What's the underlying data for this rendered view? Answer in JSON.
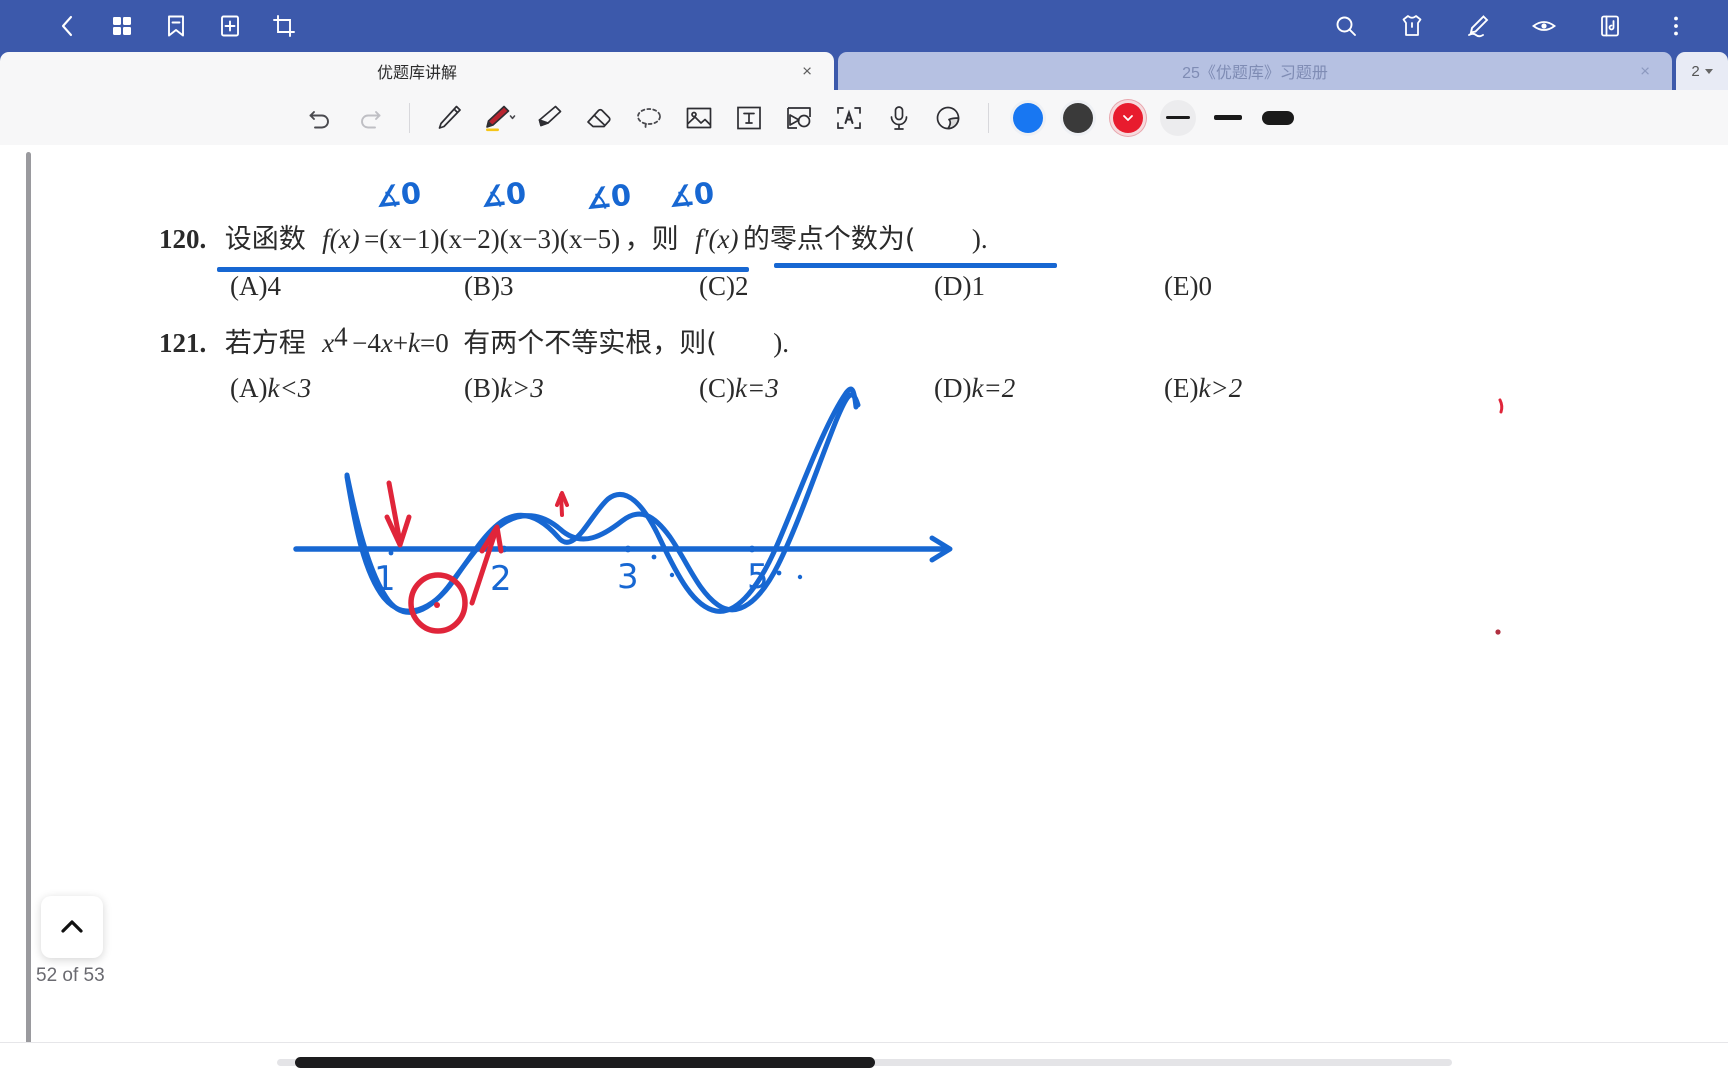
{
  "app": {
    "accent_blue": "#3c59ab",
    "ink_blue": "#1767d2",
    "ink_red": "#e0253a"
  },
  "topbar": {
    "left_icons": [
      {
        "name": "back-icon",
        "label": "Back"
      },
      {
        "name": "grid-thumbnails-icon",
        "label": "Thumbnails"
      },
      {
        "name": "bookmark-icon",
        "label": "Bookmark"
      },
      {
        "name": "add-page-icon",
        "label": "Add page"
      },
      {
        "name": "crop-icon",
        "label": "Crop"
      }
    ],
    "right_icons": [
      {
        "name": "search-icon",
        "label": "Search"
      },
      {
        "name": "shirt-icon",
        "label": "Theme"
      },
      {
        "name": "pen-edit-icon",
        "label": "Edit"
      },
      {
        "name": "eye-icon",
        "label": "View"
      },
      {
        "name": "book-note-icon",
        "label": "Notes"
      },
      {
        "name": "more-vertical-icon",
        "label": "More"
      }
    ]
  },
  "tabs": {
    "items": [
      {
        "label": "优题库讲解",
        "active": true,
        "close": "×"
      },
      {
        "label": "25《优题库》习题册",
        "active": false,
        "close": "×"
      }
    ],
    "counter": "2"
  },
  "drawbar": {
    "tools": [
      {
        "name": "undo-button",
        "label": "Undo"
      },
      {
        "name": "redo-button",
        "label": "Redo"
      },
      {
        "name": "pen-tool",
        "label": "Pen"
      },
      {
        "name": "marker-pen-tool",
        "label": "Marker pen"
      },
      {
        "name": "highlighter-tool",
        "label": "Highlighter"
      },
      {
        "name": "eraser-tool",
        "label": "Eraser"
      },
      {
        "name": "lasso-select-tool",
        "label": "Lasso select"
      },
      {
        "name": "image-insert-tool",
        "label": "Insert image"
      },
      {
        "name": "text-box-tool",
        "label": "Text box"
      },
      {
        "name": "shape-tool",
        "label": "Shapes"
      },
      {
        "name": "ocr-text-tool",
        "label": "Recognize text"
      },
      {
        "name": "microphone-tool",
        "label": "Voice note"
      },
      {
        "name": "shading-tool",
        "label": "Shading"
      }
    ],
    "colors": [
      {
        "name": "color-swatch-blue",
        "hex": "#1877f2",
        "selected": false
      },
      {
        "name": "color-swatch-black",
        "hex": "#3a3a3a",
        "selected": false
      },
      {
        "name": "color-swatch-red",
        "hex": "#e81c2e",
        "selected": true
      }
    ],
    "strokes": [
      {
        "name": "stroke-width-thin",
        "label": "Thin"
      },
      {
        "name": "stroke-width-medium",
        "label": "Medium"
      },
      {
        "name": "stroke-width-thick",
        "label": "Thick"
      }
    ]
  },
  "document": {
    "q120": {
      "number": "120.",
      "stem_cn_1": "设函数",
      "fx": "f(x)",
      "eq": "=(x−1)(x−2)(x−3)(x−5)",
      "stem_cn_2": "，则",
      "fprime": "f′(x)",
      "stem_cn_3": "的零点个数为(",
      "tail": ").",
      "options": [
        {
          "key": "(A)",
          "value": "4"
        },
        {
          "key": "(B)",
          "value": "3"
        },
        {
          "key": "(C)",
          "value": "2"
        },
        {
          "key": "(D)",
          "value": "1"
        },
        {
          "key": "(E)",
          "value": "0"
        }
      ]
    },
    "q121": {
      "number": "121.",
      "stem_cn_1": "若方程",
      "expr_base": "x",
      "expr_sup": "4",
      "expr_rest": "−4x+k=0",
      "stem_cn_2": "有两个不等实根，则(",
      "tail": ").",
      "options": [
        {
          "key": "(A)",
          "value": "k<3"
        },
        {
          "key": "(B)",
          "value": "k>3"
        },
        {
          "key": "(C)",
          "value": "k=3"
        },
        {
          "key": "(D)",
          "value": "k=2"
        },
        {
          "key": "(E)",
          "value": "k>2"
        }
      ]
    },
    "annotations": {
      "inequality_marks": [
        "∡0",
        "∡0",
        "∡0",
        "∡0"
      ],
      "axis_labels": [
        "1",
        "2",
        "3",
        "5"
      ],
      "underline_count": 2
    }
  },
  "footer": {
    "collapse_label": "Collapse toolbar",
    "page_indicator": "52 of 53"
  }
}
